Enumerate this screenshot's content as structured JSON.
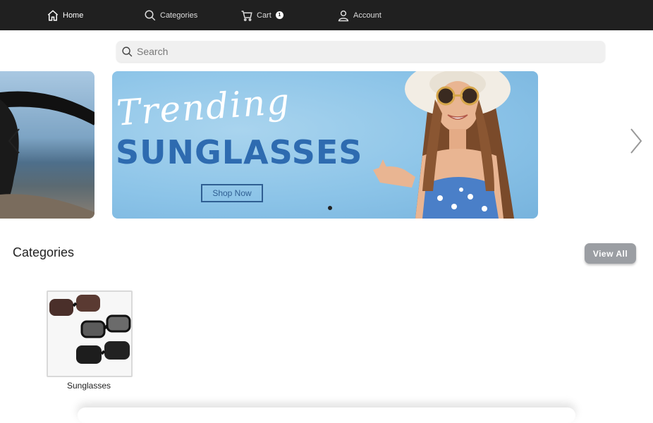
{
  "nav": {
    "home": "Home",
    "categories": "Categories",
    "cart": "Cart",
    "cart_count": "1",
    "account": "Account"
  },
  "search": {
    "placeholder": "Search"
  },
  "banner": {
    "script_text": "Trending",
    "headline": "SUNGLASSES",
    "cta": "Shop Now"
  },
  "categories": {
    "title": "Categories",
    "view_all": "View All",
    "items": [
      {
        "label": "Sunglasses"
      }
    ]
  },
  "colors": {
    "nav_bg": "#202020",
    "banner_blue": "#8cc4e8",
    "headline_blue": "#2e6bb0",
    "button_gray": "#9b9ea3"
  }
}
